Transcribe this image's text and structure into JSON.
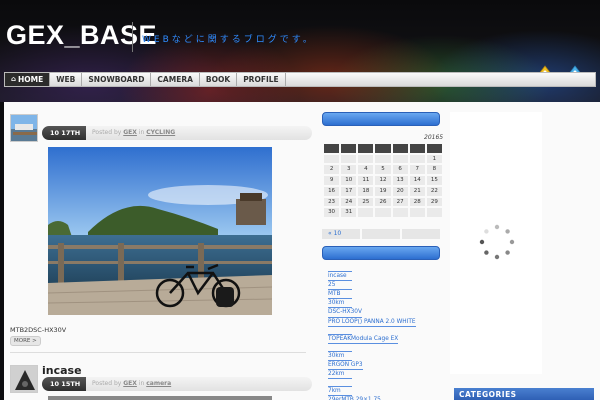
{
  "header": {
    "site_title": "GEX_BASE",
    "tagline": "WEBなどに関するブログです。"
  },
  "nav": {
    "items": [
      {
        "label": "HOME",
        "active": true
      },
      {
        "label": "WEB",
        "active": false
      },
      {
        "label": "SNOWBOARD",
        "active": false
      },
      {
        "label": "CAMERA",
        "active": false
      },
      {
        "label": "BOOK",
        "active": false
      },
      {
        "label": "PROFILE",
        "active": false
      }
    ]
  },
  "posts": [
    {
      "date": "10 17TH",
      "meta_prefix": "Posted by",
      "author": "GEX",
      "meta_in": "in",
      "category": "CYCLING",
      "caption": "MTB2DSC-HX30V",
      "more": "MORE >"
    },
    {
      "title": "incase",
      "date": "10 15TH",
      "meta_prefix": "Posted by",
      "author": "GEX",
      "meta_in": "in",
      "category": "camera"
    }
  ],
  "calendar": {
    "year_label": "20165",
    "rows": [
      [
        "",
        "",
        "",
        "",
        "",
        "",
        "1"
      ],
      [
        "2",
        "3",
        "4",
        "5",
        "6",
        "7",
        "8"
      ],
      [
        "9",
        "10",
        "11",
        "12",
        "13",
        "14",
        "15"
      ],
      [
        "16",
        "17",
        "18",
        "19",
        "20",
        "21",
        "22"
      ],
      [
        "23",
        "24",
        "25",
        "26",
        "27",
        "28",
        "29"
      ],
      [
        "30",
        "31",
        "",
        "",
        "",
        "",
        ""
      ]
    ],
    "prev_label": "« 10",
    "next_label": ""
  },
  "recent_posts": [
    "",
    "incase",
    "25",
    "MTB",
    "30km",
    "DSC-HX30V",
    "PRO LOOP() PANNA 2.0 WHITE",
    "",
    "TOPEAKModula Cage EX",
    "",
    "30km",
    "ERGON GP3",
    "22km",
    "",
    "7km",
    "29erMTB  29×1.75"
  ],
  "right_sidebar": {
    "categories_title": "CATEGORIES"
  },
  "colors": {
    "link_blue": "#2d6fd0",
    "tagline_blue": "#2f8cff",
    "widget_bar_blue": "#2d6fd0"
  }
}
